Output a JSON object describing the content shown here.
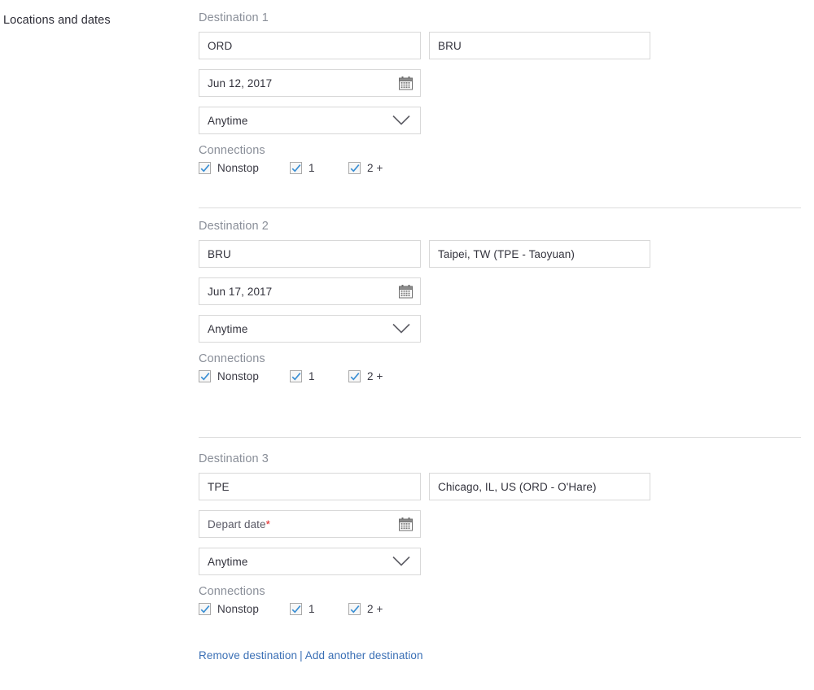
{
  "section": {
    "label": "Locations and dates"
  },
  "labels": {
    "connections": "Connections",
    "calendar_icon": "calendar-icon",
    "chevron_icon": "chevron-down-icon",
    "required_marker": "*"
  },
  "colors": {
    "link": "#3a6fb5",
    "checkmark": "#3b8fd4",
    "required": "#e02020",
    "field_border": "#d8d8d8",
    "divider": "#dcdcdc",
    "muted_text": "#8a8f99"
  },
  "destinations": [
    {
      "title": "Destination 1",
      "origin": {
        "value": "ORD"
      },
      "destination": {
        "value": "BRU"
      },
      "date": {
        "value": "Jun 12, 2017",
        "is_placeholder": false
      },
      "time": {
        "value": "Anytime"
      },
      "connections": [
        {
          "label": "Nonstop",
          "checked": true
        },
        {
          "label": "1",
          "checked": true
        },
        {
          "label": "2 +",
          "checked": true
        }
      ]
    },
    {
      "title": "Destination 2",
      "origin": {
        "value": "BRU"
      },
      "destination": {
        "value": "Taipei, TW (TPE - Taoyuan)"
      },
      "date": {
        "value": "Jun 17, 2017",
        "is_placeholder": false
      },
      "time": {
        "value": "Anytime"
      },
      "connections": [
        {
          "label": "Nonstop",
          "checked": true
        },
        {
          "label": "1",
          "checked": true
        },
        {
          "label": "2 +",
          "checked": true
        }
      ]
    },
    {
      "title": "Destination 3",
      "origin": {
        "value": "TPE"
      },
      "destination": {
        "value": "Chicago, IL, US (ORD - O'Hare)"
      },
      "date": {
        "value": "Depart date",
        "is_placeholder": true
      },
      "time": {
        "value": "Anytime"
      },
      "connections": [
        {
          "label": "Nonstop",
          "checked": true
        },
        {
          "label": "1",
          "checked": true
        },
        {
          "label": "2 +",
          "checked": true
        }
      ]
    }
  ],
  "footer": {
    "remove_label": "Remove destination",
    "separator": "|",
    "add_label": "Add another destination"
  }
}
